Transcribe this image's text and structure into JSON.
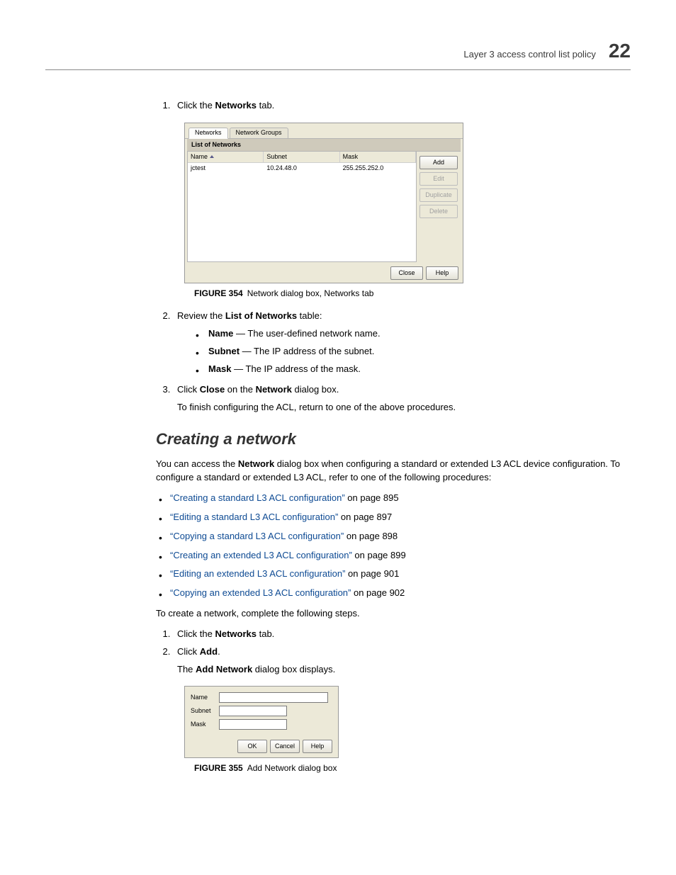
{
  "header": {
    "running_title": "Layer 3 access control list policy",
    "chapter_number": "22"
  },
  "steps_top": {
    "s1_a": "Click the ",
    "s1_b": "Networks",
    "s1_c": " tab.",
    "s2_a": "Review the ",
    "s2_b": "List of Networks",
    "s2_c": " table:",
    "b_name_b": "Name",
    "b_name_t": " — The user-defined network name.",
    "b_subnet_b": "Subnet",
    "b_subnet_t": " — The IP address of the subnet.",
    "b_mask_b": "Mask",
    "b_mask_t": " — The IP address of the mask.",
    "s3_a": "Click ",
    "s3_b": "Close",
    "s3_c": " on the ",
    "s3_d": "Network",
    "s3_e": " dialog box.",
    "s3_extra": "To finish configuring the ACL, return to one of the above procedures."
  },
  "fig354": {
    "tab_networks": "Networks",
    "tab_groups": "Network Groups",
    "subhead": "List of Networks",
    "col_name": "Name",
    "col_subnet": "Subnet",
    "col_mask": "Mask",
    "row_name": "jctest",
    "row_subnet": "10.24.48.0",
    "row_mask": "255.255.252.0",
    "btn_add": "Add",
    "btn_edit": "Edit",
    "btn_dup": "Duplicate",
    "btn_del": "Delete",
    "btn_close": "Close",
    "btn_help": "Help",
    "cap_num": "FIGURE 354",
    "cap_txt": "Network dialog box, Networks tab"
  },
  "section": {
    "heading": "Creating a network",
    "intro_a": "You can access the ",
    "intro_b": "Network",
    "intro_c": " dialog box when configuring a standard or extended L3 ACL device configuration. To configure a standard or extended L3 ACL, refer to one of the following procedures:",
    "links": [
      {
        "text": "“Creating a standard L3 ACL configuration”",
        "suffix": " on page 895"
      },
      {
        "text": "“Editing a standard L3 ACL configuration”",
        "suffix": " on page 897"
      },
      {
        "text": "“Copying a standard L3 ACL configuration”",
        "suffix": " on page 898"
      },
      {
        "text": "“Creating an extended L3 ACL configuration”",
        "suffix": " on page 899"
      },
      {
        "text": "“Editing an extended L3 ACL configuration”",
        "suffix": " on page 901"
      },
      {
        "text": "“Copying an extended L3 ACL configuration”",
        "suffix": " on page 902"
      }
    ],
    "lead2": "To create a network, complete the following steps.",
    "s1_a": "Click the ",
    "s1_b": "Networks",
    "s1_c": " tab.",
    "s2_a": "Click ",
    "s2_b": "Add",
    "s2_c": ".",
    "s2_extra_a": "The ",
    "s2_extra_b": "Add Network",
    "s2_extra_c": " dialog box displays."
  },
  "fig355": {
    "lbl_name": "Name",
    "lbl_subnet": "Subnet",
    "lbl_mask": "Mask",
    "btn_ok": "OK",
    "btn_cancel": "Cancel",
    "btn_help": "Help",
    "cap_num": "FIGURE 355",
    "cap_txt": "Add Network dialog box"
  }
}
